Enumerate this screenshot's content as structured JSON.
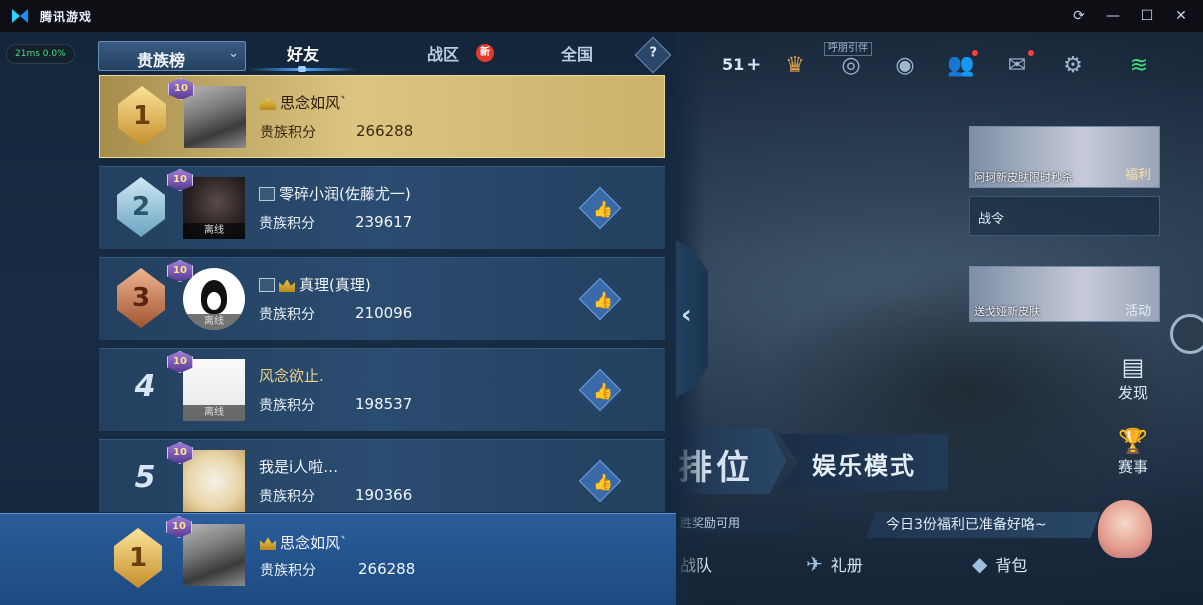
{
  "titlebar": {
    "app_name": "腾讯游戏",
    "buttons": [
      "refresh-icon",
      "minimize-icon",
      "maximize-icon",
      "close-icon"
    ]
  },
  "ping": "21ms 0.0%",
  "leaderboard": {
    "dropdown_label": "贵族榜",
    "tabs": [
      {
        "label": "好友",
        "active": true
      },
      {
        "label": "战区",
        "badge": "新"
      },
      {
        "label": "全国"
      }
    ],
    "help_label": "?",
    "score_label": "贵族积分",
    "offline_label": "离线",
    "level_label": "10",
    "rows": [
      {
        "rank": "1",
        "name": "思念如风`",
        "score": "266288",
        "highlight": true
      },
      {
        "rank": "2",
        "name": "零碎小润(佐藤尤一)",
        "score": "239617"
      },
      {
        "rank": "3",
        "name": "真理(真理)",
        "score": "210096"
      },
      {
        "rank": "4",
        "name": "风念欲止.",
        "score": "198537"
      },
      {
        "rank": "5",
        "name": "我是i人啦…",
        "score": "190366"
      }
    ],
    "me": {
      "rank": "1",
      "name": "思念如风`",
      "score": "266288"
    }
  },
  "game": {
    "currency_value": "51",
    "hidden_tag": "呼朋引伴",
    "event1_caption": "阿珂新皮肤限时秒杀",
    "event1_label": "福利",
    "battlepass_label": "战令",
    "event2_caption": "送戈娅新皮肤",
    "event2_label": "活动",
    "side_nav": [
      {
        "label": "发现",
        "icon": "calendar-icon"
      },
      {
        "label": "赛事",
        "icon": "trophy-icon"
      }
    ],
    "mode_rank": "排位",
    "mode_fun": "娱乐模式",
    "reward_text": "胜奖励可用",
    "welfare_text": "今日3份福利已准备好咯~",
    "bottom_nav": [
      {
        "label": "战队",
        "icon": "team-icon"
      },
      {
        "label": "礼册",
        "icon": "gift-book-icon"
      },
      {
        "label": "背包",
        "icon": "backpack-icon"
      }
    ]
  },
  "colors": {
    "panel": "#172c44",
    "highlight_row": "#dbc581",
    "my_row": "#2a5d9a",
    "accent": "#4daaff"
  }
}
